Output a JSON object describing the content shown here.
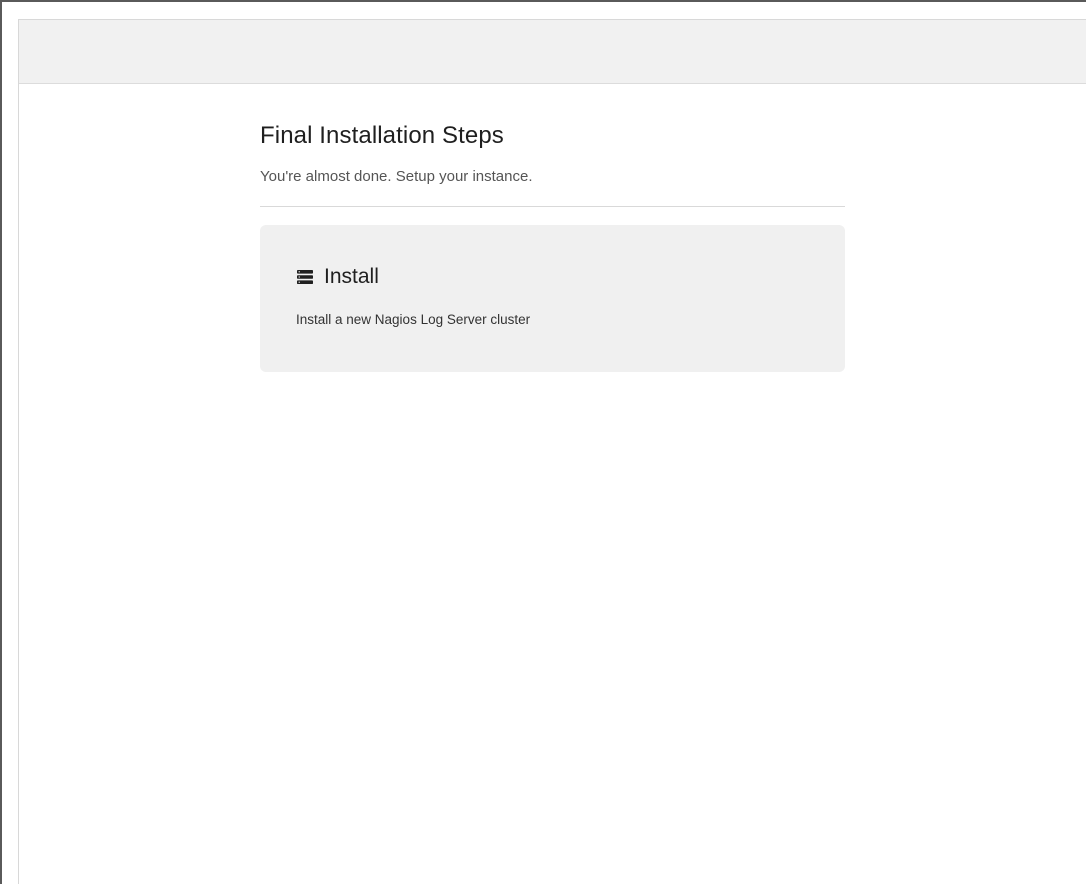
{
  "page": {
    "title": "Final Installation Steps",
    "subtitle": "You're almost done. Setup your instance."
  },
  "install_card": {
    "icon": "server-icon",
    "title": "Install",
    "description": "Install a new Nagios Log Server cluster"
  }
}
